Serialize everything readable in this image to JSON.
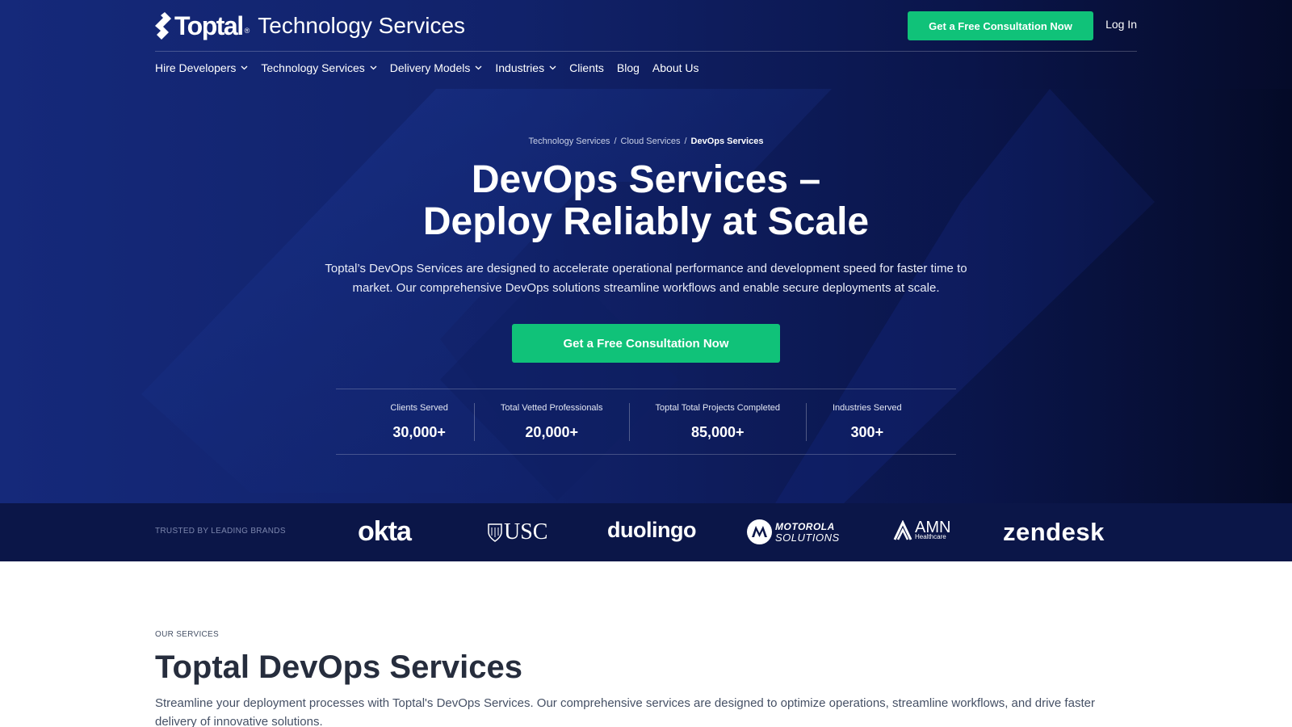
{
  "header": {
    "brand_name": "Toptal",
    "brand_reg": "®",
    "brand_subtitle": "Technology Services",
    "cta_label": "Get a Free Consultation Now",
    "login_label": "Log In"
  },
  "nav": {
    "items": [
      {
        "label": "Hire Developers",
        "has_dropdown": true
      },
      {
        "label": "Technology Services",
        "has_dropdown": true
      },
      {
        "label": "Delivery Models",
        "has_dropdown": true
      },
      {
        "label": "Industries",
        "has_dropdown": true
      },
      {
        "label": "Clients",
        "has_dropdown": false
      },
      {
        "label": "Blog",
        "has_dropdown": false
      },
      {
        "label": "About Us",
        "has_dropdown": false
      }
    ]
  },
  "breadcrumb": {
    "items": [
      "Technology Services",
      "Cloud Services",
      "DevOps Services"
    ],
    "separator": "/"
  },
  "hero": {
    "title_line1": "DevOps Services –",
    "title_line2": "Deploy Reliably at Scale",
    "description": "Toptal’s DevOps Services are designed to accelerate operational performance and development speed for faster time to market. Our comprehensive DevOps solutions streamline workflows and enable secure deployments at scale.",
    "cta_label": "Get a Free Consultation Now"
  },
  "stats": [
    {
      "label": "Clients Served",
      "value": "30,000+"
    },
    {
      "label": "Total Vetted Professionals",
      "value": "20,000+"
    },
    {
      "label": "Toptal Total Projects Completed",
      "value": "85,000+"
    },
    {
      "label": "Industries Served",
      "value": "300+"
    }
  ],
  "brands": {
    "label": "TRUSTED BY LEADING BRANDS",
    "logos": {
      "okta": "okta",
      "usc": "USC",
      "duolingo": "duolingo",
      "motorola_line1": "MOTOROLA",
      "motorola_line2": "SOLUTIONS",
      "amn_line1": "AMN",
      "amn_line2": "Healthcare",
      "zendesk": "zendesk"
    }
  },
  "services": {
    "eyebrow": "OUR SERVICES",
    "title": "Toptal DevOps Services",
    "description": "Streamline your deployment processes with Toptal's DevOps Services. Our comprehensive services are designed to optimize operations, streamline workflows, and drive faster delivery of innovative solutions."
  },
  "colors": {
    "hero_bg": "#11226a",
    "accent_green": "#10c279",
    "brand_strip_bg": "#0b1648",
    "text_dark": "#262d3d",
    "text_body": "#455065"
  },
  "icons": {
    "brand_mark": "toptal-mark-icon",
    "dropdown": "chevron-down-icon"
  }
}
